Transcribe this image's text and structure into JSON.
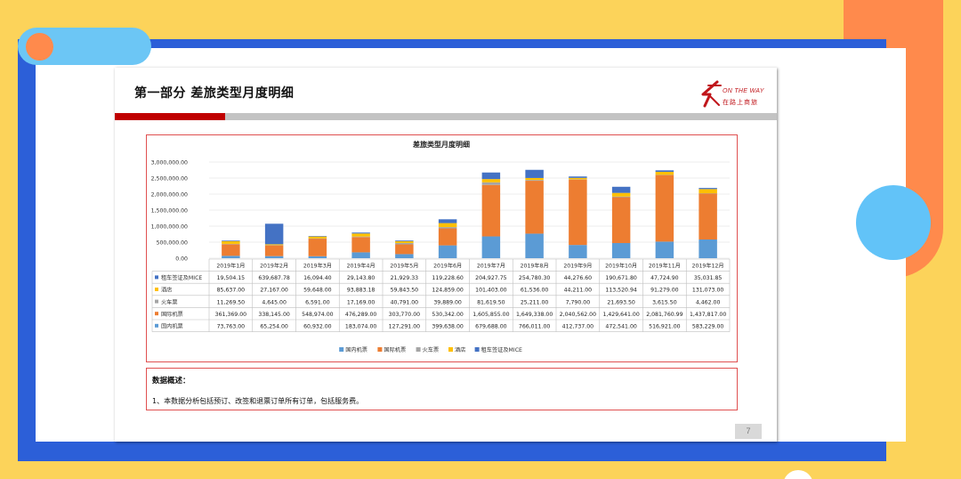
{
  "slide": {
    "title": "第一部分  差旅类型月度明细",
    "logo_en": "ON THE WAY",
    "logo_cn": "在路上商旅",
    "page_number": "7",
    "colors": {
      "accent_red": "#c00000",
      "bar_gray": "#c3c3c3",
      "frame_blue": "#2c5fd8",
      "bg_yellow": "#fcd35a",
      "orange": "#ff8a4c",
      "light_blue": "#62c3f8"
    }
  },
  "summary": {
    "heading": "数据概述：",
    "text": "1、本数据分析包括预订、改签和退票订单所有订单，包括服务费。"
  },
  "chart_data": {
    "type": "bar",
    "stacked": true,
    "title": "差旅类型月度明细",
    "ylim": [
      0,
      3000000
    ],
    "yticks": [
      "3,000,000.00",
      "2,500,000.00",
      "2,000,000.00",
      "1,500,000.00",
      "1,000,000.00",
      "500,000.00",
      "0.00"
    ],
    "categories": [
      "2019年1月",
      "2019年2月",
      "2019年3月",
      "2019年4月",
      "2019年5月",
      "2019年6月",
      "2019年7月",
      "2019年8月",
      "2019年9月",
      "2019年10月",
      "2019年11月",
      "2019年12月"
    ],
    "series": [
      {
        "name": "国内机票",
        "color": "#5b9bd5",
        "values": [
          73763.0,
          65254.0,
          60932.0,
          183074.0,
          127291.0,
          399638.0,
          679688.0,
          766011.0,
          412737.0,
          472541.0,
          516921.0,
          583229.0
        ],
        "labels": [
          "73,763.00",
          "65,254.00",
          "60,932.00",
          "183,074.00",
          "127,291.00",
          "399,638.00",
          "679,688.00",
          "766,011.00",
          "412,737.00",
          "472,541.00",
          "516,921.00",
          "583,229.00"
        ]
      },
      {
        "name": "国际机票",
        "color": "#ed7d31",
        "values": [
          361369.0,
          338145.0,
          548974.0,
          476289.0,
          303770.0,
          530342.0,
          1605855.0,
          1649338.0,
          2040562.0,
          1429641.0,
          2081760.99,
          1437817.0
        ],
        "labels": [
          "361,369.00",
          "338,145.00",
          "548,974.00",
          "476,289.00",
          "303,770.00",
          "530,342.00",
          "1,605,855.00",
          "1,649,338.00",
          "2,040,562.00",
          "1,429,641.00",
          "2,081,760.99",
          "1,437,817.00"
        ]
      },
      {
        "name": "火车票",
        "color": "#a5a5a5",
        "values": [
          11269.5,
          4645.0,
          6591.0,
          17169.0,
          40791.0,
          39889.0,
          81619.5,
          25211.0,
          7790.0,
          21693.5,
          3615.5,
          4462.0
        ],
        "labels": [
          "11,269.50",
          "4,645.00",
          "6,591.00",
          "17,169.00",
          "40,791.00",
          "39,889.00",
          "81,619.50",
          "25,211.00",
          "7,790.00",
          "21,693.50",
          "3,615.50",
          "4,462.00"
        ]
      },
      {
        "name": "酒店",
        "color": "#ffc000",
        "values": [
          85637.0,
          27167.0,
          59648.0,
          93883.18,
          59843.5,
          124859.0,
          101403.0,
          61536.0,
          44211.0,
          113520.94,
          91279.0,
          131073.0
        ],
        "labels": [
          "85,637.00",
          "27,167.00",
          "59,648.00",
          "93,883.18",
          "59,843.50",
          "124,859.00",
          "101,403.00",
          "61,536.00",
          "44,211.00",
          "113,520.94",
          "91,279.00",
          "131,073.00"
        ]
      },
      {
        "name": "租车签证及MICE",
        "color": "#4472c4",
        "values": [
          19504.15,
          639687.78,
          16094.4,
          29143.8,
          21929.33,
          119228.6,
          204927.75,
          254780.3,
          44276.6,
          190671.8,
          47724.9,
          35031.85
        ],
        "labels": [
          "19,504.15",
          "639,687.78",
          "16,094.40",
          "29,143.80",
          "21,929.33",
          "119,228.60",
          "204,927.75",
          "254,780.30",
          "44,276.60",
          "190,671.80",
          "47,724.90",
          "35,031.85"
        ]
      }
    ],
    "table_row_order": [
      "租车签证及MICE",
      "酒店",
      "火车票",
      "国际机票",
      "国内机票"
    ],
    "legend_position": "bottom",
    "grid": true
  }
}
